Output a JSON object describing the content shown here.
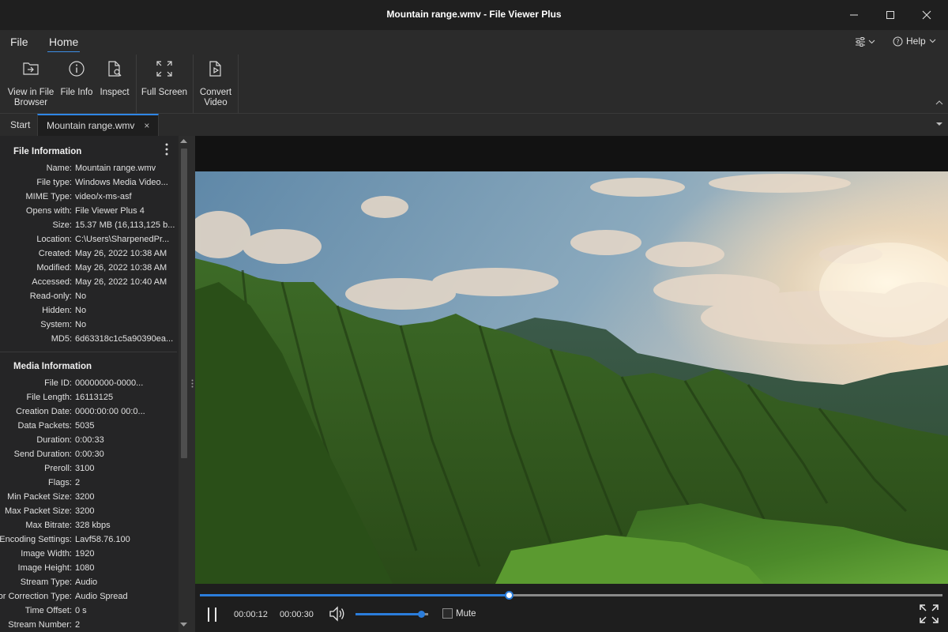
{
  "window": {
    "title": "Mountain range.wmv - File Viewer Plus",
    "minimize_icon": "minimize-icon",
    "maximize_icon": "maximize-icon",
    "close_icon": "close-icon"
  },
  "menu": {
    "file": "File",
    "home": "Home",
    "settings_icon": "sliders-icon",
    "help": "Help"
  },
  "ribbon": {
    "buttons": [
      {
        "label_line1": "View in File",
        "label_line2": "Browser",
        "icon": "folder-arrow-icon"
      },
      {
        "label_line1": "File Info",
        "label_line2": "",
        "icon": "info-circle-icon"
      },
      {
        "label_line1": "Inspect",
        "label_line2": "",
        "icon": "inspect-file-icon"
      },
      {
        "label_line1": "Full Screen",
        "label_line2": "",
        "icon": "expand-arrows-icon"
      },
      {
        "label_line1": "Convert",
        "label_line2": "Video",
        "icon": "convert-video-icon"
      }
    ]
  },
  "tabs": {
    "start": "Start",
    "active": "Mountain range.wmv",
    "close": "×"
  },
  "file_info": {
    "title": "File Information",
    "rows": [
      {
        "k": "Name:",
        "v": "Mountain range.wmv"
      },
      {
        "k": "File type:",
        "v": "Windows Media Video..."
      },
      {
        "k": "MIME Type:",
        "v": "video/x-ms-asf"
      },
      {
        "k": "Opens with:",
        "v": "File Viewer Plus 4"
      },
      {
        "k": "Size:",
        "v": "15.37 MB (16,113,125 b..."
      },
      {
        "k": "Location:",
        "v": "C:\\Users\\SharpenedPr..."
      },
      {
        "k": "Created:",
        "v": "May 26, 2022 10:38 AM"
      },
      {
        "k": "Modified:",
        "v": "May 26, 2022 10:38 AM"
      },
      {
        "k": "Accessed:",
        "v": "May 26, 2022 10:40 AM"
      },
      {
        "k": "Read-only:",
        "v": "No"
      },
      {
        "k": "Hidden:",
        "v": "No"
      },
      {
        "k": "System:",
        "v": "No"
      },
      {
        "k": "MD5:",
        "v": "6d63318c1c5a90390ea..."
      }
    ]
  },
  "media_info": {
    "title": "Media Information",
    "rows": [
      {
        "k": "File ID:",
        "v": "00000000-0000..."
      },
      {
        "k": "File Length:",
        "v": "16113125"
      },
      {
        "k": "Creation Date:",
        "v": "0000:00:00 00:0..."
      },
      {
        "k": "Data Packets:",
        "v": "5035"
      },
      {
        "k": "Duration:",
        "v": "0:00:33"
      },
      {
        "k": "Send Duration:",
        "v": "0:00:30"
      },
      {
        "k": "Preroll:",
        "v": "3100"
      },
      {
        "k": "Flags:",
        "v": "2"
      },
      {
        "k": "Min Packet Size:",
        "v": "3200"
      },
      {
        "k": "Max Packet Size:",
        "v": "3200"
      },
      {
        "k": "Max Bitrate:",
        "v": "328 kbps"
      },
      {
        "k": "Encoding Settings:",
        "v": "Lavf58.76.100"
      },
      {
        "k": "Image Width:",
        "v": "1920"
      },
      {
        "k": "Image Height:",
        "v": "1080"
      },
      {
        "k": "Stream Type:",
        "v": "Audio"
      },
      {
        "k": "Error Correction Type:",
        "v": "Audio Spread"
      },
      {
        "k": "Time Offset:",
        "v": "0 s"
      },
      {
        "k": "Stream Number:",
        "v": "2"
      }
    ]
  },
  "player": {
    "current_time": "00:00:12",
    "total_time": "00:00:30",
    "progress_fraction": 0.416,
    "volume_fraction": 0.9,
    "mute_label": "Mute",
    "muted": false,
    "pause_icon": "pause-icon",
    "volume_icon": "speaker-icon",
    "fullscreen_icon": "fullscreen-icon"
  },
  "colors": {
    "accent": "#2b7ddb",
    "background": "#1e1e1e",
    "panel": "#252526"
  }
}
